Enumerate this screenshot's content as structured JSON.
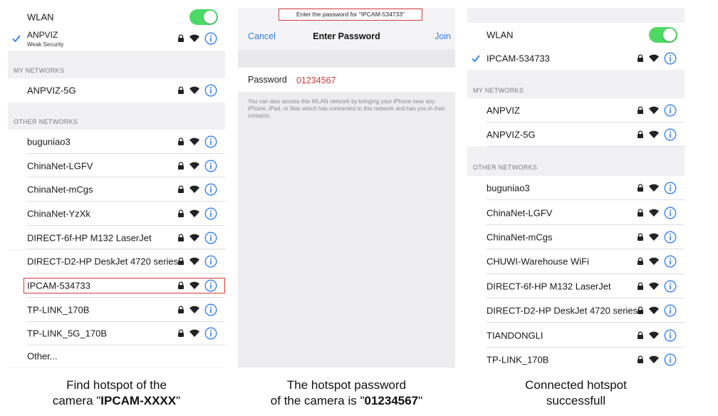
{
  "panel1": {
    "wlan_label": "WLAN",
    "connected": {
      "name": "ANPVIZ",
      "sub": "Weak Security"
    },
    "my_networks_title": "MY NETWORKS",
    "my_networks": [
      "ANPVIZ-5G"
    ],
    "other_networks_title": "OTHER NETWORKS",
    "other_networks": [
      "buguniao3",
      "ChinaNet-LGFV",
      "ChinaNet-mCgs",
      "ChinaNet-YzXk",
      "DIRECT-6f-HP M132 LaserJet",
      "DIRECT-D2-HP DeskJet 4720 series",
      "IPCAM-534733",
      "TP-LINK_170B",
      "TP-LINK_5G_170B"
    ],
    "other_label": "Other..."
  },
  "panel2": {
    "prompt": "Enter the password for \"IPCAM-534733\"",
    "cancel": "Cancel",
    "title": "Enter Password",
    "join": "Join",
    "password_label": "Password",
    "password_value": "01234567",
    "note": "You can also access this WLAN network by bringing your iPhone near any iPhone, iPad, or Mac which has connected to this network and has you in their contacts."
  },
  "panel3": {
    "wlan_label": "WLAN",
    "connected": "IPCAM-534733",
    "my_networks_title": "MY NETWORKS",
    "my_networks": [
      "ANPVIZ",
      "ANPVIZ-5G"
    ],
    "other_networks_title": "OTHER NETWORKS",
    "other_networks": [
      "buguniao3",
      "ChinaNet-LGFV",
      "ChinaNet-mCgs",
      "CHUWI-Warehouse WiFi",
      "DIRECT-6f-HP M132 LaserJet",
      "DIRECT-D2-HP DeskJet 4720 series",
      "TIANDONGLI",
      "TP-LINK_170B"
    ]
  },
  "captions": {
    "c1_line1": "Find hotspot of the",
    "c1_line2_pre": "camera \"",
    "c1_line2_bold": "IPCAM-XXXX",
    "c1_line2_post": "\"",
    "c2_line1": "The hotspot password",
    "c2_line2_pre": "of the camera is \"",
    "c2_line2_bold": "01234567",
    "c2_line2_post": "\"",
    "c3_line1": "Connected hotspot",
    "c3_line2": "successfull"
  },
  "colors": {
    "toggle_on": "#4cd964",
    "accent_blue": "#2f7cf6",
    "highlight_red": "#d23a3a"
  }
}
